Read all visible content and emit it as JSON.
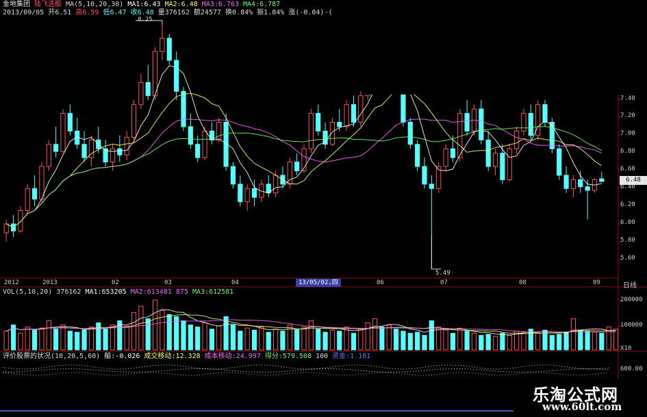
{
  "header": {
    "stock_name": "金地集团",
    "indicator": "陆飞选股",
    "ma_label": "MA(5,10,20,30)",
    "ma1": "MA1:6.43",
    "ma2": "MA2:6.48",
    "ma3": "MA3:6.763",
    "ma4": "MA4:6.787",
    "date": "2013/09/05",
    "open": "开6.51",
    "high": "高6.59",
    "low": "低6.47",
    "close": "收6.48",
    "volume": "量376162",
    "amount": "额24577",
    "turnover": "换0.84%",
    "amplitude": "振1.84%",
    "change": "涨(-0.04)-("
  },
  "vol_panel": {
    "label": "VOL(5,10,20)",
    "value": "376162",
    "ma1": "MA1:653205",
    "ma2": "MA2:613481",
    "ma2_tail": "875",
    "ma3": "MA3:612581"
  },
  "bottom_panel": {
    "label": "评价股票的状况(10,20,5,60)",
    "item1": "船:-0.026",
    "item2": "成交移动:12.328",
    "item3": "成本移动:24.997",
    "item4": "得分:579.508",
    "item5": "100",
    "item6": "资金:1.101"
  },
  "price_axis": [
    "7.40",
    "7.20",
    "7.00",
    "6.80",
    "6.60",
    "6.40",
    "6.20",
    "6.00",
    "5.80",
    "5.60"
  ],
  "current_price_tag": "6.48",
  "vol_axis": [
    "200000",
    "100000"
  ],
  "vol_axis_unit": "X10",
  "bottom_axis": [
    "600.00"
  ],
  "date_axis": [
    "2012",
    "2013",
    "02",
    "03",
    "04",
    "13/05/02,四",
    "06",
    "07",
    "08",
    "09"
  ],
  "period_label": "日线",
  "annotations": {
    "high_label": "8.25",
    "low_label": "5.49"
  },
  "watermark": {
    "title": "乐淘公式网",
    "url": "www.60lt.com"
  },
  "colors": {
    "up": "#ff5555",
    "down": "#54ffff",
    "ma5": "#ffffff",
    "ma10": "#ffff66",
    "ma20": "#ff66ff",
    "ma30": "#66ff66",
    "axis_text": "#cfcfcf",
    "grid": "#8a1111"
  },
  "chart_data": {
    "type": "candlestick",
    "price_range": [
      5.45,
      8.3
    ],
    "volume_range": [
      0,
      260000
    ],
    "candles": [
      {
        "o": 5.9,
        "h": 6.05,
        "l": 5.8,
        "c": 6.0
      },
      {
        "o": 6.0,
        "h": 6.1,
        "l": 5.85,
        "c": 5.92
      },
      {
        "o": 5.92,
        "h": 6.2,
        "l": 5.9,
        "c": 6.15
      },
      {
        "o": 6.15,
        "h": 6.45,
        "l": 6.1,
        "c": 6.4
      },
      {
        "o": 6.4,
        "h": 6.55,
        "l": 6.2,
        "c": 6.28
      },
      {
        "o": 6.28,
        "h": 6.7,
        "l": 6.25,
        "c": 6.65
      },
      {
        "o": 6.65,
        "h": 6.95,
        "l": 6.6,
        "c": 6.9
      },
      {
        "o": 6.9,
        "h": 7.1,
        "l": 6.75,
        "c": 6.82
      },
      {
        "o": 6.82,
        "h": 7.3,
        "l": 6.8,
        "c": 7.25
      },
      {
        "o": 7.25,
        "h": 7.35,
        "l": 7.0,
        "c": 7.05
      },
      {
        "o": 7.05,
        "h": 7.2,
        "l": 6.85,
        "c": 6.9
      },
      {
        "o": 6.9,
        "h": 7.05,
        "l": 6.7,
        "c": 6.75
      },
      {
        "o": 6.75,
        "h": 7.0,
        "l": 6.65,
        "c": 6.95
      },
      {
        "o": 6.95,
        "h": 7.1,
        "l": 6.8,
        "c": 6.85
      },
      {
        "o": 6.85,
        "h": 6.95,
        "l": 6.65,
        "c": 6.7
      },
      {
        "o": 6.7,
        "h": 6.9,
        "l": 6.6,
        "c": 6.85
      },
      {
        "o": 6.85,
        "h": 7.0,
        "l": 6.7,
        "c": 6.78
      },
      {
        "o": 6.78,
        "h": 7.05,
        "l": 6.72,
        "c": 6.98
      },
      {
        "o": 6.98,
        "h": 7.4,
        "l": 6.95,
        "c": 7.35
      },
      {
        "o": 7.35,
        "h": 7.7,
        "l": 7.3,
        "c": 7.6
      },
      {
        "o": 7.6,
        "h": 7.8,
        "l": 7.4,
        "c": 7.45
      },
      {
        "o": 7.45,
        "h": 8.0,
        "l": 7.4,
        "c": 7.95
      },
      {
        "o": 7.95,
        "h": 8.25,
        "l": 7.85,
        "c": 8.1
      },
      {
        "o": 8.1,
        "h": 8.15,
        "l": 7.8,
        "c": 7.85
      },
      {
        "o": 7.85,
        "h": 7.95,
        "l": 7.4,
        "c": 7.5
      },
      {
        "o": 7.5,
        "h": 7.55,
        "l": 7.05,
        "c": 7.1
      },
      {
        "o": 7.1,
        "h": 7.25,
        "l": 6.85,
        "c": 6.9
      },
      {
        "o": 6.9,
        "h": 7.0,
        "l": 6.7,
        "c": 6.75
      },
      {
        "o": 6.75,
        "h": 7.1,
        "l": 6.72,
        "c": 7.05
      },
      {
        "o": 7.05,
        "h": 7.15,
        "l": 6.9,
        "c": 6.95
      },
      {
        "o": 6.95,
        "h": 7.2,
        "l": 6.92,
        "c": 7.15
      },
      {
        "o": 7.15,
        "h": 7.25,
        "l": 6.6,
        "c": 6.65
      },
      {
        "o": 6.65,
        "h": 6.7,
        "l": 6.4,
        "c": 6.45
      },
      {
        "o": 6.45,
        "h": 6.55,
        "l": 6.2,
        "c": 6.25
      },
      {
        "o": 6.25,
        "h": 6.45,
        "l": 6.15,
        "c": 6.4
      },
      {
        "o": 6.4,
        "h": 6.5,
        "l": 6.2,
        "c": 6.3
      },
      {
        "o": 6.3,
        "h": 6.5,
        "l": 6.25,
        "c": 6.45
      },
      {
        "o": 6.45,
        "h": 6.55,
        "l": 6.3,
        "c": 6.35
      },
      {
        "o": 6.35,
        "h": 6.6,
        "l": 6.3,
        "c": 6.55
      },
      {
        "o": 6.55,
        "h": 6.65,
        "l": 6.4,
        "c": 6.45
      },
      {
        "o": 6.45,
        "h": 6.75,
        "l": 6.4,
        "c": 6.7
      },
      {
        "o": 6.7,
        "h": 6.8,
        "l": 6.55,
        "c": 6.6
      },
      {
        "o": 6.6,
        "h": 6.9,
        "l": 6.58,
        "c": 6.85
      },
      {
        "o": 6.85,
        "h": 7.3,
        "l": 6.8,
        "c": 7.25
      },
      {
        "o": 7.25,
        "h": 7.35,
        "l": 7.0,
        "c": 7.05
      },
      {
        "o": 7.05,
        "h": 7.15,
        "l": 6.85,
        "c": 6.9
      },
      {
        "o": 6.9,
        "h": 7.2,
        "l": 6.88,
        "c": 7.15
      },
      {
        "o": 7.15,
        "h": 7.3,
        "l": 7.05,
        "c": 7.1
      },
      {
        "o": 7.1,
        "h": 7.4,
        "l": 7.05,
        "c": 7.35
      },
      {
        "o": 7.35,
        "h": 7.45,
        "l": 7.1,
        "c": 7.15
      },
      {
        "o": 7.15,
        "h": 7.5,
        "l": 7.1,
        "c": 7.45
      },
      {
        "o": 7.45,
        "h": 7.8,
        "l": 7.4,
        "c": 7.75
      },
      {
        "o": 7.75,
        "h": 8.05,
        "l": 7.7,
        "c": 7.95
      },
      {
        "o": 7.95,
        "h": 8.0,
        "l": 7.55,
        "c": 7.6
      },
      {
        "o": 7.6,
        "h": 7.95,
        "l": 7.55,
        "c": 7.9
      },
      {
        "o": 7.9,
        "h": 8.1,
        "l": 7.75,
        "c": 7.8
      },
      {
        "o": 7.8,
        "h": 7.9,
        "l": 7.1,
        "c": 7.15
      },
      {
        "o": 7.15,
        "h": 7.2,
        "l": 6.85,
        "c": 6.9
      },
      {
        "o": 6.9,
        "h": 6.95,
        "l": 6.6,
        "c": 6.65
      },
      {
        "o": 6.65,
        "h": 6.75,
        "l": 6.4,
        "c": 6.45
      },
      {
        "o": 6.45,
        "h": 6.55,
        "l": 5.49,
        "c": 6.4
      },
      {
        "o": 6.4,
        "h": 6.7,
        "l": 6.35,
        "c": 6.65
      },
      {
        "o": 6.65,
        "h": 6.9,
        "l": 6.6,
        "c": 6.85
      },
      {
        "o": 6.85,
        "h": 7.0,
        "l": 6.7,
        "c": 6.75
      },
      {
        "o": 6.75,
        "h": 7.3,
        "l": 6.7,
        "c": 7.25
      },
      {
        "o": 7.25,
        "h": 7.4,
        "l": 7.0,
        "c": 7.05
      },
      {
        "o": 7.05,
        "h": 7.35,
        "l": 7.0,
        "c": 7.3
      },
      {
        "o": 7.3,
        "h": 7.4,
        "l": 6.9,
        "c": 6.95
      },
      {
        "o": 6.95,
        "h": 7.05,
        "l": 6.6,
        "c": 6.65
      },
      {
        "o": 6.65,
        "h": 6.85,
        "l": 6.55,
        "c": 6.8
      },
      {
        "o": 6.8,
        "h": 6.9,
        "l": 6.45,
        "c": 6.5
      },
      {
        "o": 6.5,
        "h": 6.9,
        "l": 6.48,
        "c": 6.85
      },
      {
        "o": 6.85,
        "h": 7.1,
        "l": 6.8,
        "c": 7.05
      },
      {
        "o": 7.05,
        "h": 7.3,
        "l": 7.0,
        "c": 7.25
      },
      {
        "o": 7.25,
        "h": 7.35,
        "l": 6.95,
        "c": 7.0
      },
      {
        "o": 7.0,
        "h": 7.4,
        "l": 6.95,
        "c": 7.35
      },
      {
        "o": 7.35,
        "h": 7.4,
        "l": 7.1,
        "c": 7.15
      },
      {
        "o": 7.15,
        "h": 7.2,
        "l": 6.8,
        "c": 6.85
      },
      {
        "o": 6.85,
        "h": 6.9,
        "l": 6.5,
        "c": 6.55
      },
      {
        "o": 6.55,
        "h": 6.65,
        "l": 6.35,
        "c": 6.4
      },
      {
        "o": 6.4,
        "h": 6.55,
        "l": 6.3,
        "c": 6.5
      },
      {
        "o": 6.5,
        "h": 6.6,
        "l": 6.35,
        "c": 6.42
      },
      {
        "o": 6.42,
        "h": 6.5,
        "l": 6.05,
        "c": 6.38
      },
      {
        "o": 6.38,
        "h": 6.52,
        "l": 6.35,
        "c": 6.5
      },
      {
        "o": 6.51,
        "h": 6.59,
        "l": 6.47,
        "c": 6.48
      }
    ],
    "volumes": [
      90000,
      120000,
      80000,
      110000,
      95000,
      105000,
      140000,
      100000,
      120000,
      90000,
      85000,
      95000,
      110000,
      130000,
      100000,
      120000,
      140000,
      115000,
      180000,
      210000,
      150000,
      240000,
      190000,
      170000,
      160000,
      140000,
      120000,
      110000,
      130000,
      100000,
      115000,
      160000,
      120000,
      90000,
      105000,
      95000,
      110000,
      85000,
      100000,
      90000,
      120000,
      95000,
      110000,
      140000,
      100000,
      85000,
      95000,
      90000,
      110000,
      80000,
      100000,
      130000,
      150000,
      110000,
      120000,
      100000,
      90000,
      80000,
      85000,
      70000,
      140000,
      110000,
      95000,
      80000,
      100000,
      90000,
      80000,
      70000,
      75000,
      65000,
      80000,
      70000,
      90000,
      85000,
      100000,
      80000,
      95000,
      70000,
      75000,
      85000,
      150000,
      95000,
      90000,
      85000,
      80000,
      110000,
      100000
    ],
    "vol_ma_levels": [
      110000,
      100000,
      95000
    ]
  }
}
